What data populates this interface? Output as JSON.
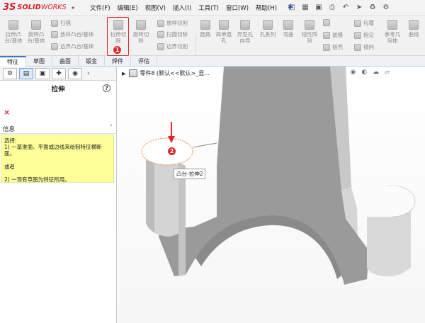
{
  "app": {
    "logo_mark": "3S",
    "logo_solid": "SOLID",
    "logo_works": "WORKS"
  },
  "menu": [
    "文件(F)",
    "编辑(E)",
    "视图(V)",
    "插入(I)",
    "工具(T)",
    "窗口(W)",
    "帮助(H)"
  ],
  "commands": {
    "extrude_boss": "拉伸凸\n台/基体",
    "revolve_boss": "旋转凸\n台/基体",
    "sweep": "扫描",
    "loft": "放样凸台/基体",
    "boundary": "边界凸台/基体",
    "extrude_cut": "拉伸切\n除",
    "revolve_cut": "旋转切\n除",
    "loft_cut": "放样切割",
    "sweep_cut": "扫描切除",
    "boundary_cut": "边界切割",
    "fillet": "圆角",
    "hole_simple": "简单直\n孔",
    "hole_wizard": "异型孔\n向导",
    "hole_series": "孔系列",
    "rib": "弯曲",
    "linear_pattern": "线性阵\n列",
    "draft": "拔模",
    "shell": "抽壳",
    "wrap": "包覆",
    "intersect": "相交",
    "mirror": "镜向",
    "ref_geometry": "参考几\n何体",
    "curves": "曲线"
  },
  "tabs": [
    "特征",
    "草图",
    "曲面",
    "钣金",
    "焊件",
    "评估"
  ],
  "active_tab": "特征",
  "panel": {
    "title": "拉伸",
    "help": "?",
    "cancel": "×",
    "info_header": "信息",
    "info_text": "选择:\n1) 一基准面、平面或边线来绘制特征横断面。\n\n或者\n\n2) 一现有草图为特征所用。"
  },
  "viewport": {
    "tree_label": "零件8  (默认<<默认>_显...",
    "tooltip": "凸台-拉伸2"
  },
  "badges": {
    "step1": "1",
    "step2": "2"
  },
  "colors": {
    "brand": "#d71920",
    "highlight": "#e0262c",
    "info_bg": "#ffff99",
    "model_face": "#9a9a9a",
    "model_side": "#d8d8d8"
  }
}
